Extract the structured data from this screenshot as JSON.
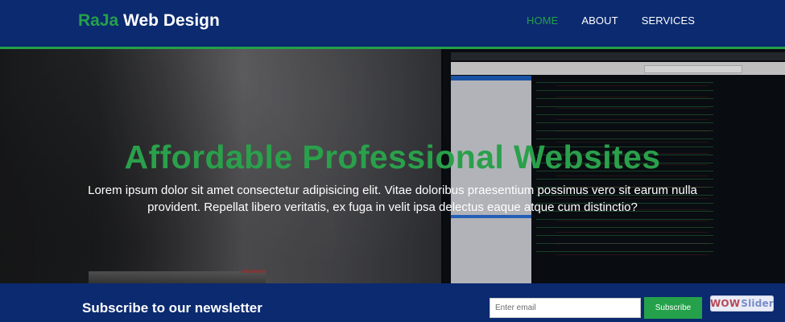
{
  "header": {
    "brand": {
      "accent": "RaJa",
      "rest": " Web Design"
    },
    "nav": [
      {
        "label": "HOME",
        "active": true
      },
      {
        "label": "ABOUT",
        "active": false
      },
      {
        "label": "SERVICES",
        "active": false
      }
    ]
  },
  "hero": {
    "title": "Affordable Professional Websites",
    "text": "Lorem ipsum dolor sit amet consectetur adipisicing elit. Vitae doloribus praesentium possimus vero sit earum nulla provident. Repellat libero veritatis, ex fuga in velit ipsa delectus eaque atque cum distinctio?"
  },
  "newsletter": {
    "title": "Subscribe to our newsletter",
    "email_placeholder": "Enter email",
    "button_label": "Subscribe"
  },
  "badge": {
    "part1": "WOW",
    "part2": "Slider"
  },
  "colors": {
    "navy": "#0b2a6f",
    "green": "#24a14a"
  }
}
